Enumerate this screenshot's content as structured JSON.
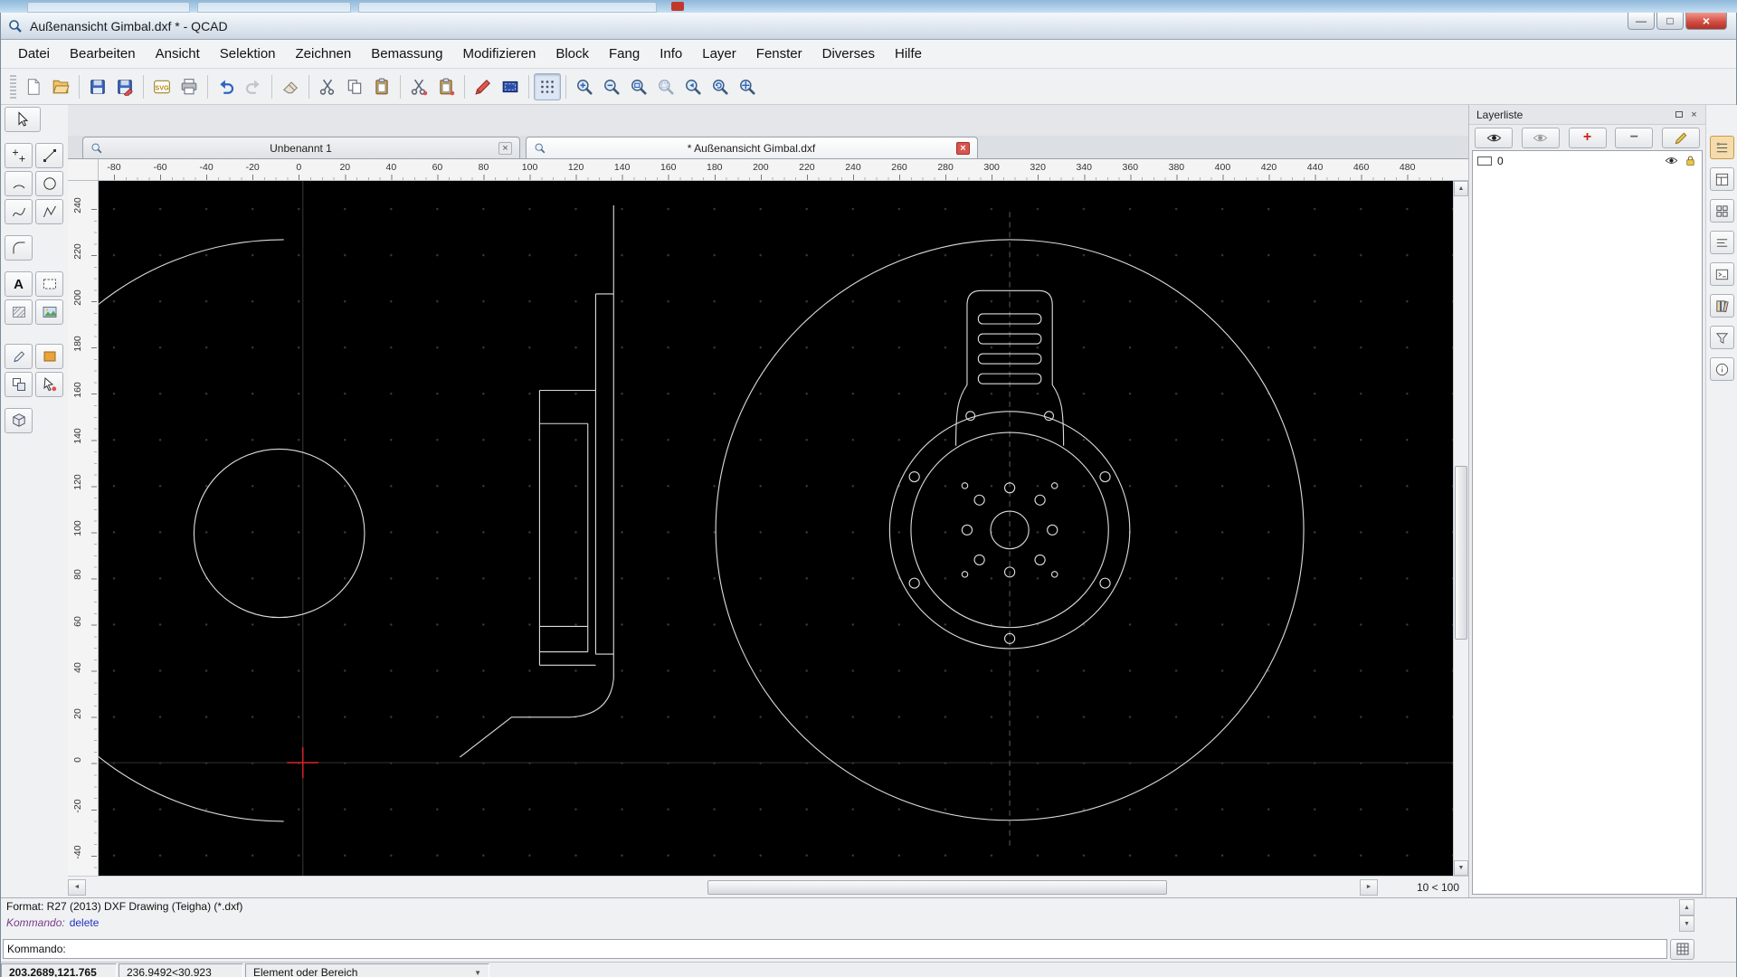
{
  "window": {
    "title": "Außenansicht Gimbal.dxf * - QCAD"
  },
  "menu": {
    "items": [
      "Datei",
      "Bearbeiten",
      "Ansicht",
      "Selektion",
      "Zeichnen",
      "Bemassung",
      "Modifizieren",
      "Block",
      "Fang",
      "Info",
      "Layer",
      "Fenster",
      "Diverses",
      "Hilfe"
    ]
  },
  "document_tabs": {
    "tab1": {
      "label": "Unbenannt 1"
    },
    "tab2": {
      "label": "* Außenansicht Gimbal.dxf"
    }
  },
  "rulers": {
    "horizontal": [
      "-80",
      "-60",
      "-40",
      "-20",
      "0",
      "20",
      "40",
      "60",
      "80",
      "100",
      "120",
      "140",
      "160",
      "180",
      "200",
      "220",
      "240",
      "260",
      "280",
      "300",
      "320",
      "340",
      "360",
      "380",
      "400",
      "420",
      "440",
      "460",
      "480"
    ],
    "vertical": [
      "240",
      "220",
      "200",
      "180",
      "160",
      "140",
      "120",
      "100",
      "80",
      "60",
      "40",
      "20",
      "0",
      "-20",
      "-40"
    ]
  },
  "layer_panel": {
    "title": "Layerliste",
    "layers": [
      {
        "name": "0"
      }
    ]
  },
  "scrollbar": {
    "grid_label": "10 < 100"
  },
  "status": {
    "format_line": "Format: R27 (2013) DXF Drawing (Teigha) (*.dxf)",
    "history_label": "Kommando:",
    "history_value": "delete",
    "prompt_label": "Kommando:",
    "coord_absolute": "203.2689,121.765",
    "coord_relative": "236.9492<30.923",
    "hint": "Element oder Bereich"
  },
  "icons": {
    "plus": "+",
    "minus": "−",
    "close": "×",
    "minimize": "—",
    "maximize": "□",
    "text_tool": "A",
    "svg_label": "SVG",
    "arrow_up": "▲",
    "arrow_down": "▼",
    "arrow_left": "◄",
    "arrow_right": "►"
  },
  "colors": {
    "canvas_bg": "#000000",
    "drawing_line": "#dcdcdc",
    "crosshair": "#cc2222",
    "accent_close": "#d0493f"
  }
}
